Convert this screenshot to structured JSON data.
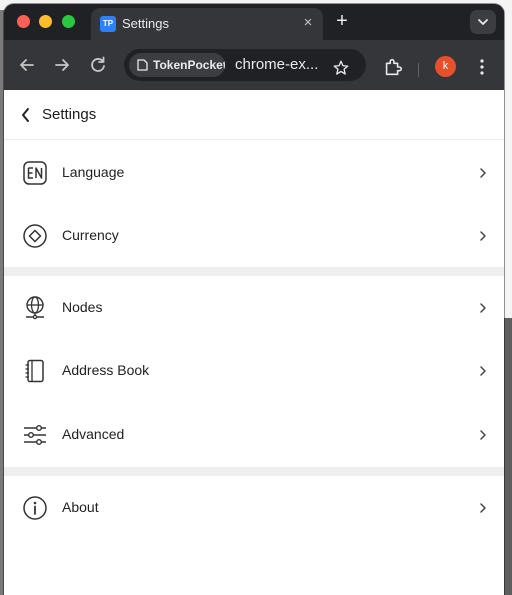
{
  "browser": {
    "tab_title": "Settings",
    "tab_favicon_text": "TP",
    "tab_close": "×",
    "new_tab": "+",
    "site_chip": "TokenPocket",
    "url": "chrome-ex...",
    "avatar_letter": "k"
  },
  "colors": {
    "favicon": "#2f80ff",
    "avatar": "#e8502b",
    "close": "#fe5f57",
    "minimize": "#febc2e",
    "maximize": "#28c840"
  },
  "page": {
    "title": "Settings"
  },
  "settings": {
    "items": [
      {
        "label": "Language",
        "icon": "language-icon"
      },
      {
        "label": "Currency",
        "icon": "currency-icon"
      },
      {
        "label": "Nodes",
        "icon": "nodes-icon"
      },
      {
        "label": "Address Book",
        "icon": "address-book-icon"
      },
      {
        "label": "Advanced",
        "icon": "advanced-icon"
      },
      {
        "label": "About",
        "icon": "info-icon"
      }
    ]
  }
}
